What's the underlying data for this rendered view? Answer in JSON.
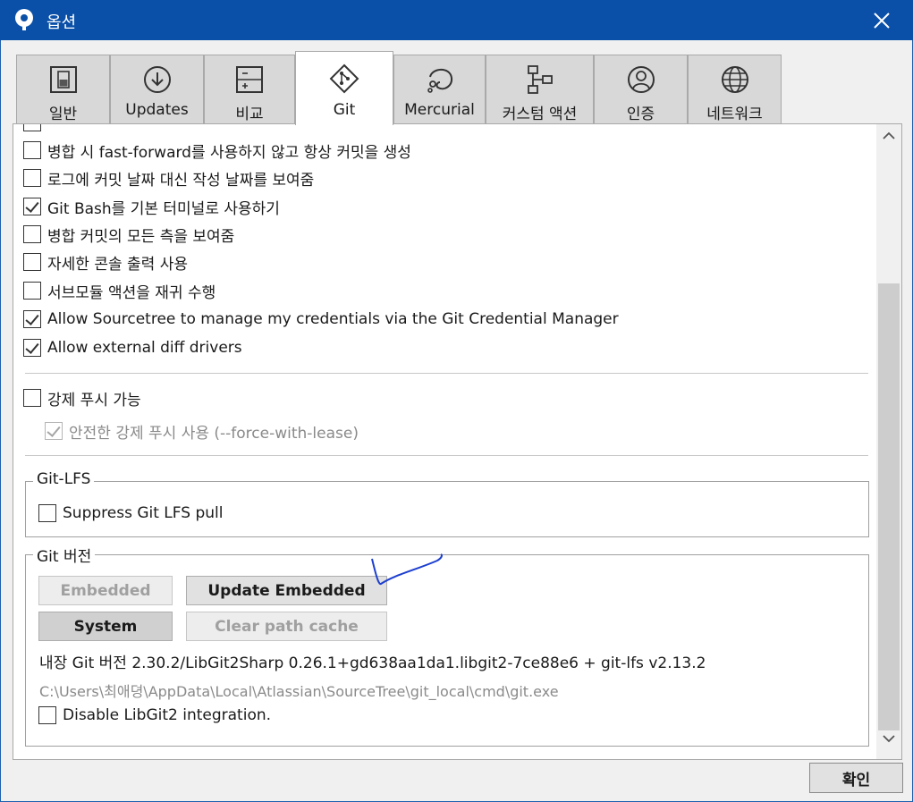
{
  "window": {
    "title": "옵션"
  },
  "tabs": [
    {
      "label": "일반",
      "icon": "toggle-switch-icon"
    },
    {
      "label": "Updates",
      "icon": "download-circle-icon"
    },
    {
      "label": "비교",
      "icon": "compare-icon"
    },
    {
      "label": "Git",
      "icon": "git-diamond-icon",
      "active": true
    },
    {
      "label": "Mercurial",
      "icon": "mercurial-icon"
    },
    {
      "label": "커스텀 액션",
      "icon": "custom-action-icon"
    },
    {
      "label": "인증",
      "icon": "user-circle-icon"
    },
    {
      "label": "네트워크",
      "icon": "globe-icon"
    }
  ],
  "options": [
    {
      "label": "병합 시 fast-forward를 사용하지 않고 항상 커밋을 생성",
      "checked": false
    },
    {
      "label": "로그에 커밋 날짜 대신 작성 날짜를 보여줌",
      "checked": false
    },
    {
      "label": "Git Bash를 기본 터미널로 사용하기",
      "checked": true
    },
    {
      "label": "병합 커밋의 모든 측을 보여줌",
      "checked": false
    },
    {
      "label": "자세한 콘솔 출력 사용",
      "checked": false
    },
    {
      "label": "서브모듈 액션을 재귀 수행",
      "checked": false
    },
    {
      "label": "Allow Sourcetree to manage my credentials via the Git Credential Manager",
      "checked": true
    },
    {
      "label": "Allow external diff drivers",
      "checked": true
    }
  ],
  "force_push": {
    "label": "강제 푸시 가능",
    "checked": false,
    "safe_label": "안전한 강제 푸시 사용 (--force-with-lease)",
    "safe_checked": true
  },
  "git_lfs": {
    "title": "Git-LFS",
    "suppress_label": "Suppress Git LFS pull",
    "suppress_checked": false
  },
  "git_version": {
    "title": "Git 버전",
    "embedded_button": "Embedded",
    "update_embedded_button": "Update Embedded",
    "system_button": "System",
    "clear_cache_button": "Clear path cache",
    "version_text": "내장 Git 버전 2.30.2/LibGit2Sharp 0.26.1+gd638aa1da1.libgit2-7ce88e6 + git-lfs v2.13.2",
    "path_text": "C:\\Users\\최애뎡\\AppData\\Local\\Atlassian\\SourceTree\\git_local\\cmd\\git.exe",
    "disable_libgit2_label": "Disable LibGit2 integration.",
    "disable_libgit2_checked": false
  },
  "footer": {
    "ok_label": "확인"
  },
  "colors": {
    "titlebar": "#0a50a8",
    "annotation_stroke": "#1d3fd0"
  }
}
